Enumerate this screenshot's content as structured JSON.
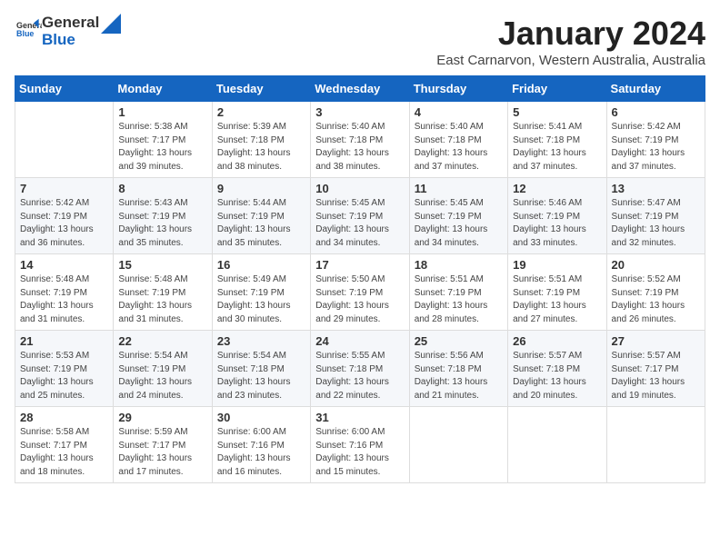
{
  "header": {
    "logo_line1": "General",
    "logo_line2": "Blue",
    "title": "January 2024",
    "subtitle": "East Carnarvon, Western Australia, Australia"
  },
  "weekdays": [
    "Sunday",
    "Monday",
    "Tuesday",
    "Wednesday",
    "Thursday",
    "Friday",
    "Saturday"
  ],
  "weeks": [
    [
      {
        "day": "",
        "info": ""
      },
      {
        "day": "1",
        "info": "Sunrise: 5:38 AM\nSunset: 7:17 PM\nDaylight: 13 hours\nand 39 minutes."
      },
      {
        "day": "2",
        "info": "Sunrise: 5:39 AM\nSunset: 7:18 PM\nDaylight: 13 hours\nand 38 minutes."
      },
      {
        "day": "3",
        "info": "Sunrise: 5:40 AM\nSunset: 7:18 PM\nDaylight: 13 hours\nand 38 minutes."
      },
      {
        "day": "4",
        "info": "Sunrise: 5:40 AM\nSunset: 7:18 PM\nDaylight: 13 hours\nand 37 minutes."
      },
      {
        "day": "5",
        "info": "Sunrise: 5:41 AM\nSunset: 7:18 PM\nDaylight: 13 hours\nand 37 minutes."
      },
      {
        "day": "6",
        "info": "Sunrise: 5:42 AM\nSunset: 7:19 PM\nDaylight: 13 hours\nand 37 minutes."
      }
    ],
    [
      {
        "day": "7",
        "info": "Sunrise: 5:42 AM\nSunset: 7:19 PM\nDaylight: 13 hours\nand 36 minutes."
      },
      {
        "day": "8",
        "info": "Sunrise: 5:43 AM\nSunset: 7:19 PM\nDaylight: 13 hours\nand 35 minutes."
      },
      {
        "day": "9",
        "info": "Sunrise: 5:44 AM\nSunset: 7:19 PM\nDaylight: 13 hours\nand 35 minutes."
      },
      {
        "day": "10",
        "info": "Sunrise: 5:45 AM\nSunset: 7:19 PM\nDaylight: 13 hours\nand 34 minutes."
      },
      {
        "day": "11",
        "info": "Sunrise: 5:45 AM\nSunset: 7:19 PM\nDaylight: 13 hours\nand 34 minutes."
      },
      {
        "day": "12",
        "info": "Sunrise: 5:46 AM\nSunset: 7:19 PM\nDaylight: 13 hours\nand 33 minutes."
      },
      {
        "day": "13",
        "info": "Sunrise: 5:47 AM\nSunset: 7:19 PM\nDaylight: 13 hours\nand 32 minutes."
      }
    ],
    [
      {
        "day": "14",
        "info": "Sunrise: 5:48 AM\nSunset: 7:19 PM\nDaylight: 13 hours\nand 31 minutes."
      },
      {
        "day": "15",
        "info": "Sunrise: 5:48 AM\nSunset: 7:19 PM\nDaylight: 13 hours\nand 31 minutes."
      },
      {
        "day": "16",
        "info": "Sunrise: 5:49 AM\nSunset: 7:19 PM\nDaylight: 13 hours\nand 30 minutes."
      },
      {
        "day": "17",
        "info": "Sunrise: 5:50 AM\nSunset: 7:19 PM\nDaylight: 13 hours\nand 29 minutes."
      },
      {
        "day": "18",
        "info": "Sunrise: 5:51 AM\nSunset: 7:19 PM\nDaylight: 13 hours\nand 28 minutes."
      },
      {
        "day": "19",
        "info": "Sunrise: 5:51 AM\nSunset: 7:19 PM\nDaylight: 13 hours\nand 27 minutes."
      },
      {
        "day": "20",
        "info": "Sunrise: 5:52 AM\nSunset: 7:19 PM\nDaylight: 13 hours\nand 26 minutes."
      }
    ],
    [
      {
        "day": "21",
        "info": "Sunrise: 5:53 AM\nSunset: 7:19 PM\nDaylight: 13 hours\nand 25 minutes."
      },
      {
        "day": "22",
        "info": "Sunrise: 5:54 AM\nSunset: 7:19 PM\nDaylight: 13 hours\nand 24 minutes."
      },
      {
        "day": "23",
        "info": "Sunrise: 5:54 AM\nSunset: 7:18 PM\nDaylight: 13 hours\nand 23 minutes."
      },
      {
        "day": "24",
        "info": "Sunrise: 5:55 AM\nSunset: 7:18 PM\nDaylight: 13 hours\nand 22 minutes."
      },
      {
        "day": "25",
        "info": "Sunrise: 5:56 AM\nSunset: 7:18 PM\nDaylight: 13 hours\nand 21 minutes."
      },
      {
        "day": "26",
        "info": "Sunrise: 5:57 AM\nSunset: 7:18 PM\nDaylight: 13 hours\nand 20 minutes."
      },
      {
        "day": "27",
        "info": "Sunrise: 5:57 AM\nSunset: 7:17 PM\nDaylight: 13 hours\nand 19 minutes."
      }
    ],
    [
      {
        "day": "28",
        "info": "Sunrise: 5:58 AM\nSunset: 7:17 PM\nDaylight: 13 hours\nand 18 minutes."
      },
      {
        "day": "29",
        "info": "Sunrise: 5:59 AM\nSunset: 7:17 PM\nDaylight: 13 hours\nand 17 minutes."
      },
      {
        "day": "30",
        "info": "Sunrise: 6:00 AM\nSunset: 7:16 PM\nDaylight: 13 hours\nand 16 minutes."
      },
      {
        "day": "31",
        "info": "Sunrise: 6:00 AM\nSunset: 7:16 PM\nDaylight: 13 hours\nand 15 minutes."
      },
      {
        "day": "",
        "info": ""
      },
      {
        "day": "",
        "info": ""
      },
      {
        "day": "",
        "info": ""
      }
    ]
  ]
}
